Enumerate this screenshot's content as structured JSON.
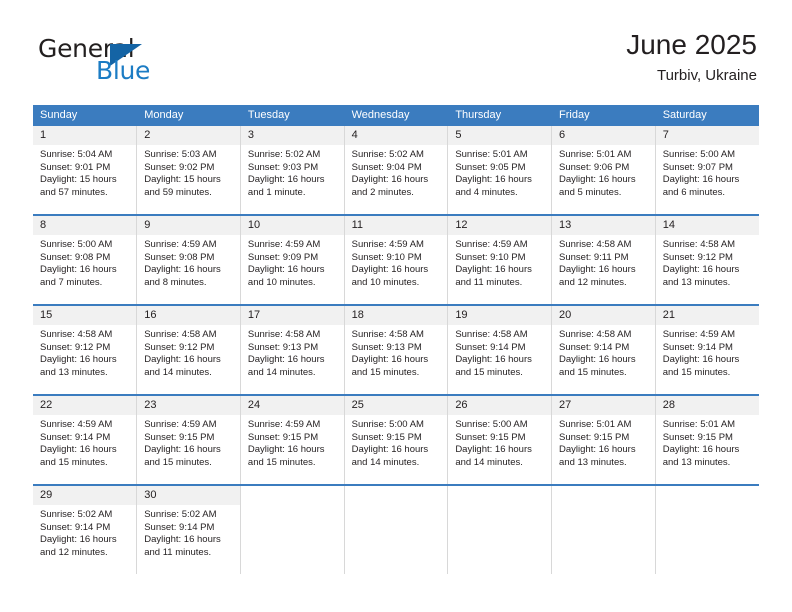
{
  "brand": {
    "name_top": "General",
    "name_bottom": "Blue",
    "triangle_color": "#1464a5",
    "blue_text_color": "#1c7cc4"
  },
  "header": {
    "title": "June 2025",
    "subtitle": "Turbiv, Ukraine"
  },
  "theme": {
    "header_bg": "#3b7cbf",
    "header_text": "#ffffff",
    "daynum_bg": "#f1f1f1",
    "row_rule": "#3b7cbf",
    "cell_divider": "#d8d8d8",
    "body_text": "#231f20"
  },
  "calendar": {
    "weekday_headers": [
      "Sunday",
      "Monday",
      "Tuesday",
      "Wednesday",
      "Thursday",
      "Friday",
      "Saturday"
    ],
    "weeks": [
      [
        {
          "day": "1",
          "sunrise": "Sunrise: 5:04 AM",
          "sunset": "Sunset: 9:01 PM",
          "daylight_line1": "Daylight: 15 hours",
          "daylight_line2": "and 57 minutes."
        },
        {
          "day": "2",
          "sunrise": "Sunrise: 5:03 AM",
          "sunset": "Sunset: 9:02 PM",
          "daylight_line1": "Daylight: 15 hours",
          "daylight_line2": "and 59 minutes."
        },
        {
          "day": "3",
          "sunrise": "Sunrise: 5:02 AM",
          "sunset": "Sunset: 9:03 PM",
          "daylight_line1": "Daylight: 16 hours",
          "daylight_line2": "and 1 minute."
        },
        {
          "day": "4",
          "sunrise": "Sunrise: 5:02 AM",
          "sunset": "Sunset: 9:04 PM",
          "daylight_line1": "Daylight: 16 hours",
          "daylight_line2": "and 2 minutes."
        },
        {
          "day": "5",
          "sunrise": "Sunrise: 5:01 AM",
          "sunset": "Sunset: 9:05 PM",
          "daylight_line1": "Daylight: 16 hours",
          "daylight_line2": "and 4 minutes."
        },
        {
          "day": "6",
          "sunrise": "Sunrise: 5:01 AM",
          "sunset": "Sunset: 9:06 PM",
          "daylight_line1": "Daylight: 16 hours",
          "daylight_line2": "and 5 minutes."
        },
        {
          "day": "7",
          "sunrise": "Sunrise: 5:00 AM",
          "sunset": "Sunset: 9:07 PM",
          "daylight_line1": "Daylight: 16 hours",
          "daylight_line2": "and 6 minutes."
        }
      ],
      [
        {
          "day": "8",
          "sunrise": "Sunrise: 5:00 AM",
          "sunset": "Sunset: 9:08 PM",
          "daylight_line1": "Daylight: 16 hours",
          "daylight_line2": "and 7 minutes."
        },
        {
          "day": "9",
          "sunrise": "Sunrise: 4:59 AM",
          "sunset": "Sunset: 9:08 PM",
          "daylight_line1": "Daylight: 16 hours",
          "daylight_line2": "and 8 minutes."
        },
        {
          "day": "10",
          "sunrise": "Sunrise: 4:59 AM",
          "sunset": "Sunset: 9:09 PM",
          "daylight_line1": "Daylight: 16 hours",
          "daylight_line2": "and 10 minutes."
        },
        {
          "day": "11",
          "sunrise": "Sunrise: 4:59 AM",
          "sunset": "Sunset: 9:10 PM",
          "daylight_line1": "Daylight: 16 hours",
          "daylight_line2": "and 10 minutes."
        },
        {
          "day": "12",
          "sunrise": "Sunrise: 4:59 AM",
          "sunset": "Sunset: 9:10 PM",
          "daylight_line1": "Daylight: 16 hours",
          "daylight_line2": "and 11 minutes."
        },
        {
          "day": "13",
          "sunrise": "Sunrise: 4:58 AM",
          "sunset": "Sunset: 9:11 PM",
          "daylight_line1": "Daylight: 16 hours",
          "daylight_line2": "and 12 minutes."
        },
        {
          "day": "14",
          "sunrise": "Sunrise: 4:58 AM",
          "sunset": "Sunset: 9:12 PM",
          "daylight_line1": "Daylight: 16 hours",
          "daylight_line2": "and 13 minutes."
        }
      ],
      [
        {
          "day": "15",
          "sunrise": "Sunrise: 4:58 AM",
          "sunset": "Sunset: 9:12 PM",
          "daylight_line1": "Daylight: 16 hours",
          "daylight_line2": "and 13 minutes."
        },
        {
          "day": "16",
          "sunrise": "Sunrise: 4:58 AM",
          "sunset": "Sunset: 9:12 PM",
          "daylight_line1": "Daylight: 16 hours",
          "daylight_line2": "and 14 minutes."
        },
        {
          "day": "17",
          "sunrise": "Sunrise: 4:58 AM",
          "sunset": "Sunset: 9:13 PM",
          "daylight_line1": "Daylight: 16 hours",
          "daylight_line2": "and 14 minutes."
        },
        {
          "day": "18",
          "sunrise": "Sunrise: 4:58 AM",
          "sunset": "Sunset: 9:13 PM",
          "daylight_line1": "Daylight: 16 hours",
          "daylight_line2": "and 15 minutes."
        },
        {
          "day": "19",
          "sunrise": "Sunrise: 4:58 AM",
          "sunset": "Sunset: 9:14 PM",
          "daylight_line1": "Daylight: 16 hours",
          "daylight_line2": "and 15 minutes."
        },
        {
          "day": "20",
          "sunrise": "Sunrise: 4:58 AM",
          "sunset": "Sunset: 9:14 PM",
          "daylight_line1": "Daylight: 16 hours",
          "daylight_line2": "and 15 minutes."
        },
        {
          "day": "21",
          "sunrise": "Sunrise: 4:59 AM",
          "sunset": "Sunset: 9:14 PM",
          "daylight_line1": "Daylight: 16 hours",
          "daylight_line2": "and 15 minutes."
        }
      ],
      [
        {
          "day": "22",
          "sunrise": "Sunrise: 4:59 AM",
          "sunset": "Sunset: 9:14 PM",
          "daylight_line1": "Daylight: 16 hours",
          "daylight_line2": "and 15 minutes."
        },
        {
          "day": "23",
          "sunrise": "Sunrise: 4:59 AM",
          "sunset": "Sunset: 9:15 PM",
          "daylight_line1": "Daylight: 16 hours",
          "daylight_line2": "and 15 minutes."
        },
        {
          "day": "24",
          "sunrise": "Sunrise: 4:59 AM",
          "sunset": "Sunset: 9:15 PM",
          "daylight_line1": "Daylight: 16 hours",
          "daylight_line2": "and 15 minutes."
        },
        {
          "day": "25",
          "sunrise": "Sunrise: 5:00 AM",
          "sunset": "Sunset: 9:15 PM",
          "daylight_line1": "Daylight: 16 hours",
          "daylight_line2": "and 14 minutes."
        },
        {
          "day": "26",
          "sunrise": "Sunrise: 5:00 AM",
          "sunset": "Sunset: 9:15 PM",
          "daylight_line1": "Daylight: 16 hours",
          "daylight_line2": "and 14 minutes."
        },
        {
          "day": "27",
          "sunrise": "Sunrise: 5:01 AM",
          "sunset": "Sunset: 9:15 PM",
          "daylight_line1": "Daylight: 16 hours",
          "daylight_line2": "and 13 minutes."
        },
        {
          "day": "28",
          "sunrise": "Sunrise: 5:01 AM",
          "sunset": "Sunset: 9:15 PM",
          "daylight_line1": "Daylight: 16 hours",
          "daylight_line2": "and 13 minutes."
        }
      ],
      [
        {
          "day": "29",
          "sunrise": "Sunrise: 5:02 AM",
          "sunset": "Sunset: 9:14 PM",
          "daylight_line1": "Daylight: 16 hours",
          "daylight_line2": "and 12 minutes."
        },
        {
          "day": "30",
          "sunrise": "Sunrise: 5:02 AM",
          "sunset": "Sunset: 9:14 PM",
          "daylight_line1": "Daylight: 16 hours",
          "daylight_line2": "and 11 minutes."
        },
        {
          "day": "",
          "sunrise": "",
          "sunset": "",
          "daylight_line1": "",
          "daylight_line2": ""
        },
        {
          "day": "",
          "sunrise": "",
          "sunset": "",
          "daylight_line1": "",
          "daylight_line2": ""
        },
        {
          "day": "",
          "sunrise": "",
          "sunset": "",
          "daylight_line1": "",
          "daylight_line2": ""
        },
        {
          "day": "",
          "sunrise": "",
          "sunset": "",
          "daylight_line1": "",
          "daylight_line2": ""
        },
        {
          "day": "",
          "sunrise": "",
          "sunset": "",
          "daylight_line1": "",
          "daylight_line2": ""
        }
      ]
    ]
  }
}
